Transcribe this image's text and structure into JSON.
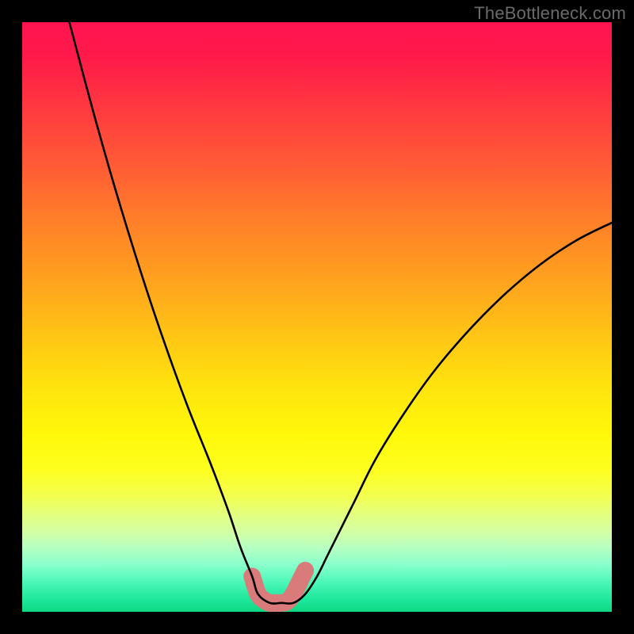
{
  "watermark": "TheBottleneck.com",
  "chart_data": {
    "type": "line",
    "title": "",
    "xlabel": "",
    "ylabel": "",
    "xlim": [
      0,
      100
    ],
    "ylim": [
      0,
      100
    ],
    "grid": false,
    "legend": false,
    "annotations": [],
    "series": [
      {
        "name": "bottleneck-curve",
        "x": [
          8,
          12,
          16,
          20,
          24,
          28,
          32,
          35,
          37,
          39,
          40,
          42,
          44,
          46,
          48,
          50,
          52,
          56,
          60,
          65,
          70,
          76,
          82,
          88,
          94,
          100
        ],
        "y": [
          100,
          85,
          71,
          58,
          46,
          35,
          25,
          17,
          11,
          6,
          3,
          1.5,
          1.5,
          1.5,
          3,
          6,
          10,
          18,
          26,
          34,
          41,
          48,
          54,
          59,
          63,
          66
        ]
      },
      {
        "name": "highlight-region",
        "x": [
          39,
          40,
          41,
          42,
          43,
          44,
          45,
          46,
          47,
          48
        ],
        "y": [
          6,
          3,
          2,
          1.5,
          1.5,
          1.5,
          1.8,
          3,
          5,
          7
        ]
      }
    ],
    "styles": {
      "bottleneck-curve": {
        "stroke": "#000000",
        "width": 2.5
      },
      "highlight-region": {
        "stroke": "#d97b7b",
        "width": 18,
        "linecap": "round"
      }
    }
  }
}
